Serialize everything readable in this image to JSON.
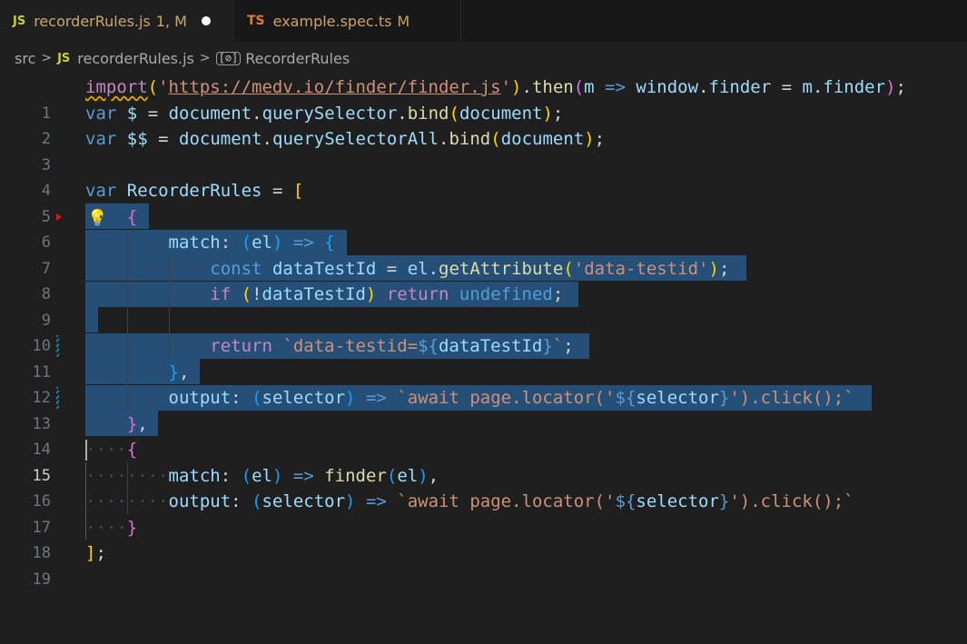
{
  "tabs": [
    {
      "badge": "JS",
      "name": "recorderRules.js",
      "status": "1, M",
      "dirty": true
    },
    {
      "badge": "TS",
      "name": "example.spec.ts",
      "status": "M"
    }
  ],
  "breadcrumb": {
    "folder": "src",
    "file_badge": "JS",
    "file": "recorderRules.js",
    "symbol_icon": "symbol-variable-icon",
    "symbol": "RecorderRules"
  },
  "editor": {
    "line_numbers": [
      "1",
      "2",
      "3",
      "4",
      "5",
      "6",
      "7",
      "8",
      "9",
      "10",
      "11",
      "12",
      "13",
      "14",
      "15",
      "16",
      "17",
      "18",
      "19"
    ],
    "current_line": 15,
    "selected_lines": "6-14",
    "line1": {
      "kw": "import",
      "url": "https://medv.io/finder/finder.js",
      "then": "then",
      "m": "m",
      "window": "window",
      "finder": "finder",
      "m2": "m",
      "finder2": "finder"
    },
    "line2": {
      "kw": "var",
      "id": "$",
      "document": "document",
      "fn": "querySelector",
      "bind": "bind",
      "arg": "document"
    },
    "line3": {
      "kw": "var",
      "id": "$$",
      "document": "document",
      "fn": "querySelectorAll",
      "bind": "bind",
      "arg": "document"
    },
    "line5": {
      "kw": "var",
      "id": "RecorderRules"
    },
    "line7": {
      "prop": "match",
      "param": "el"
    },
    "line8": {
      "kw": "const",
      "id": "dataTestId",
      "obj": "el",
      "fn": "getAttribute",
      "str": "'data-testid'"
    },
    "line9": {
      "kw": "if",
      "id": "dataTestId",
      "ret": "return",
      "undef": "undefined"
    },
    "line11": {
      "ret": "return",
      "tpl_start": "`data-testid=",
      "id": "dataTestId",
      "tpl_end": "`"
    },
    "line13": {
      "prop": "output",
      "param": "selector",
      "tpl_a": "`await page.locator('",
      "id": "selector",
      "tpl_b": "').click();`"
    },
    "line16": {
      "prop": "match",
      "param": "el",
      "fn": "finder",
      "arg": "el"
    },
    "line17": {
      "prop": "output",
      "param": "selector",
      "tpl_a": "`await page.locator('",
      "id": "selector",
      "tpl_b": "').click();`"
    }
  },
  "colors": {
    "selection": "#264f78",
    "background": "#1f1f1f",
    "lightbulb": "#ffcc00"
  }
}
